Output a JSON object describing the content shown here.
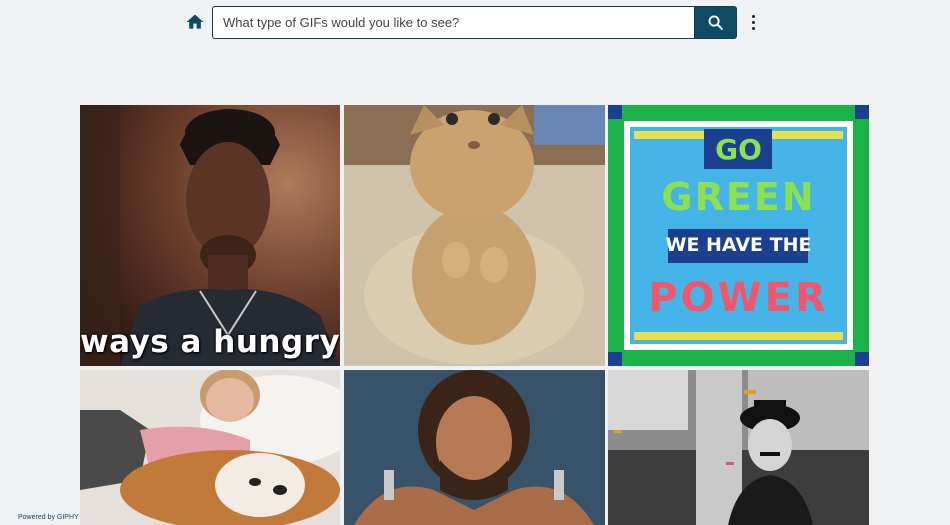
{
  "search": {
    "placeholder": "What type of GIFs would you like to see?",
    "value": ""
  },
  "icons": {
    "home": "home-icon",
    "search": "search-icon",
    "menu": "more-vert-icon"
  },
  "colors": {
    "accent": "#0f4a63",
    "background": "#f0f1f2"
  },
  "gifs": [
    {
      "caption": "ways a hungry"
    },
    {
      "caption": ""
    },
    {
      "lines": [
        "GO",
        "GREEN",
        "WE HAVE THE",
        "POWER"
      ]
    },
    {
      "caption": ""
    },
    {
      "caption": ""
    },
    {
      "caption": ""
    }
  ],
  "footer": {
    "powered_by": "Powered by GIPHY"
  }
}
